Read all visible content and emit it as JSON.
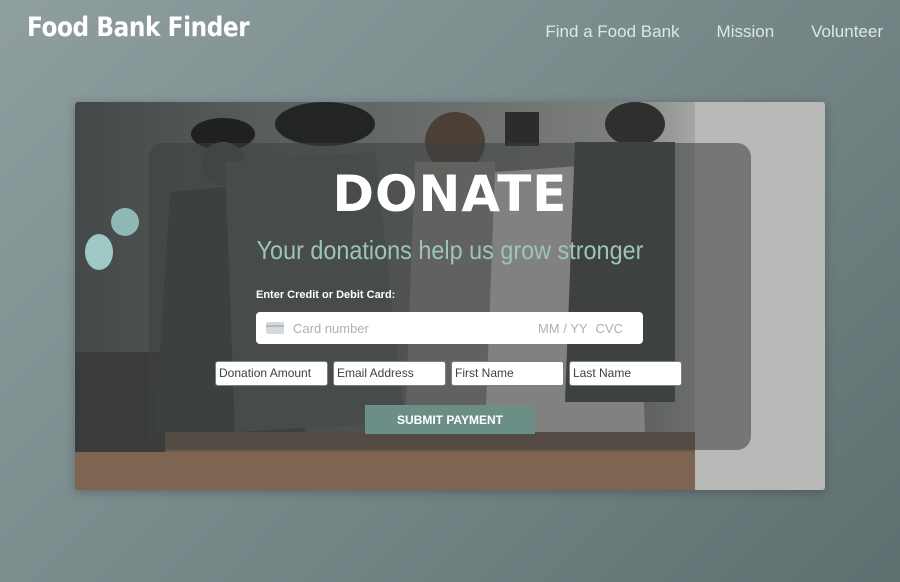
{
  "header": {
    "brand": "Food Bank Finder",
    "nav": [
      "Find a Food Bank",
      "Mission",
      "Volunteer"
    ]
  },
  "donate": {
    "title": "DONATE",
    "tagline": "Your donations help us grow stronger",
    "card_label": "Enter Credit or Debit Card:",
    "card_number_placeholder": "Card number",
    "expiry_placeholder": "MM / YY",
    "cvc_placeholder": "CVC",
    "fields": {
      "donation_amount": "Donation Amount",
      "email": "Email Address",
      "first_name": "First Name",
      "last_name": "Last Name"
    },
    "submit_label": "SUBMIT PAYMENT"
  },
  "colors": {
    "accent": "#6b8f87",
    "tagline": "#9ec3b8"
  }
}
